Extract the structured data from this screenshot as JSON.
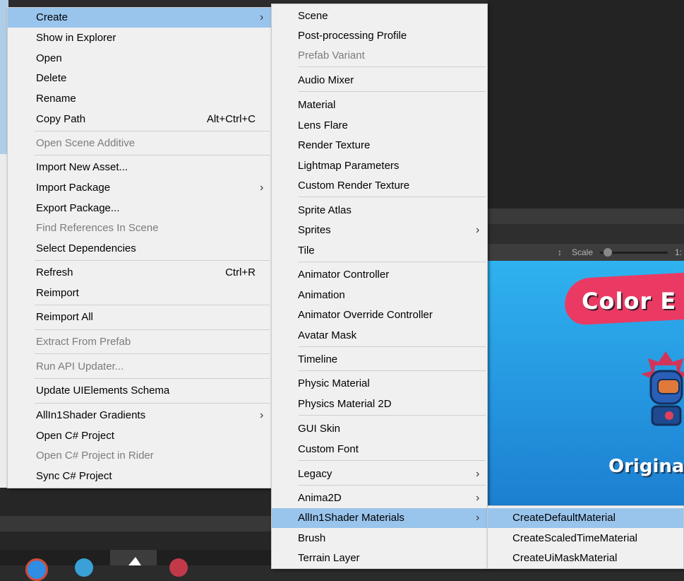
{
  "game": {
    "toolbar": {
      "scale_label": "Scale",
      "scale_arrows": "↕",
      "scale_value": "1:"
    },
    "title": "Color E",
    "subtitle": "Original"
  },
  "context_menu": {
    "items": [
      {
        "label": "Create",
        "highlighted": true,
        "submenu": true
      },
      {
        "label": "Show in Explorer"
      },
      {
        "label": "Open"
      },
      {
        "label": "Delete"
      },
      {
        "label": "Rename"
      },
      {
        "label": "Copy Path",
        "shortcut": "Alt+Ctrl+C"
      },
      {
        "label": "Open Scene Additive",
        "disabled": true
      },
      {
        "label": "Import New Asset..."
      },
      {
        "label": "Import Package",
        "submenu": true
      },
      {
        "label": "Export Package..."
      },
      {
        "label": "Find References In Scene",
        "disabled": true
      },
      {
        "label": "Select Dependencies"
      },
      {
        "label": "Refresh",
        "shortcut": "Ctrl+R"
      },
      {
        "label": "Reimport"
      },
      {
        "label": "Reimport All"
      },
      {
        "label": "Extract From Prefab",
        "disabled": true
      },
      {
        "label": "Run API Updater...",
        "disabled": true
      },
      {
        "label": "Update UIElements Schema"
      },
      {
        "label": "AllIn1Shader Gradients",
        "submenu": true
      },
      {
        "label": "Open C# Project"
      },
      {
        "label": "Open C# Project in Rider",
        "disabled": true
      },
      {
        "label": "Sync C# Project"
      }
    ]
  },
  "create_submenu": {
    "items": [
      {
        "label": "Scene"
      },
      {
        "label": "Post-processing Profile"
      },
      {
        "label": "Prefab Variant",
        "disabled": true
      },
      {
        "label": "Audio Mixer"
      },
      {
        "label": "Material"
      },
      {
        "label": "Lens Flare"
      },
      {
        "label": "Render Texture"
      },
      {
        "label": "Lightmap Parameters"
      },
      {
        "label": "Custom Render Texture"
      },
      {
        "label": "Sprite Atlas"
      },
      {
        "label": "Sprites",
        "submenu": true
      },
      {
        "label": "Tile"
      },
      {
        "label": "Animator Controller"
      },
      {
        "label": "Animation"
      },
      {
        "label": "Animator Override Controller"
      },
      {
        "label": "Avatar Mask"
      },
      {
        "label": "Timeline"
      },
      {
        "label": "Physic Material"
      },
      {
        "label": "Physics Material 2D"
      },
      {
        "label": "GUI Skin"
      },
      {
        "label": "Custom Font"
      },
      {
        "label": "Legacy",
        "submenu": true
      },
      {
        "label": "Anima2D",
        "submenu": true
      },
      {
        "label": "AllIn1Shader Materials",
        "highlighted": true,
        "submenu": true
      },
      {
        "label": "Brush"
      },
      {
        "label": "Terrain Layer"
      }
    ]
  },
  "shader_submenu": {
    "items": [
      {
        "label": "CreateDefaultMaterial",
        "highlighted": true
      },
      {
        "label": "CreateScaledTimeMaterial"
      },
      {
        "label": "CreateUiMaskMaterial"
      }
    ]
  },
  "colors": {
    "menu_bg": "#f0f0f0",
    "highlight": "#99c4ec",
    "disabled_text": "#7c7c7c",
    "game_pink": "#ea3a63",
    "game_blue": "#2596e0"
  }
}
